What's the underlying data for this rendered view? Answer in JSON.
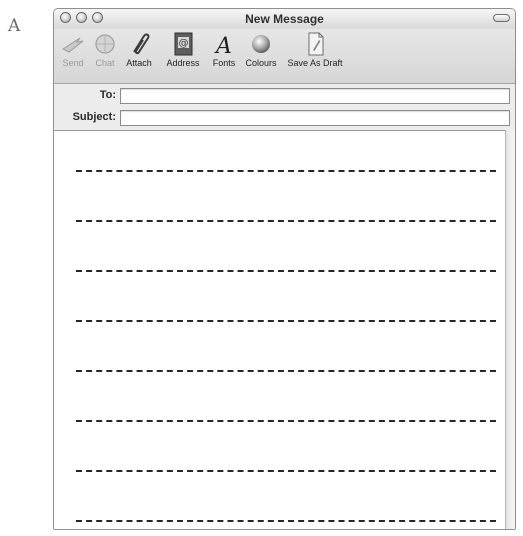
{
  "figure_label": "A",
  "window": {
    "title": "New Message"
  },
  "toolbar": {
    "items": [
      {
        "label": "Send",
        "icon": "send-icon",
        "enabled": false
      },
      {
        "label": "Chat",
        "icon": "chat-icon",
        "enabled": false
      },
      {
        "label": "Attach",
        "icon": "paperclip-icon",
        "enabled": true
      },
      {
        "label": "Address",
        "icon": "address-book-icon",
        "enabled": true
      },
      {
        "label": "Fonts",
        "icon": "fonts-icon",
        "enabled": true
      },
      {
        "label": "Colours",
        "icon": "colours-icon",
        "enabled": true
      },
      {
        "label": "Save As Draft",
        "icon": "draft-icon",
        "enabled": true
      }
    ]
  },
  "header": {
    "to_label": "To:",
    "to_value": "",
    "subject_label": "Subject:",
    "subject_value": ""
  },
  "body": {
    "ruled_line_count": 8
  }
}
